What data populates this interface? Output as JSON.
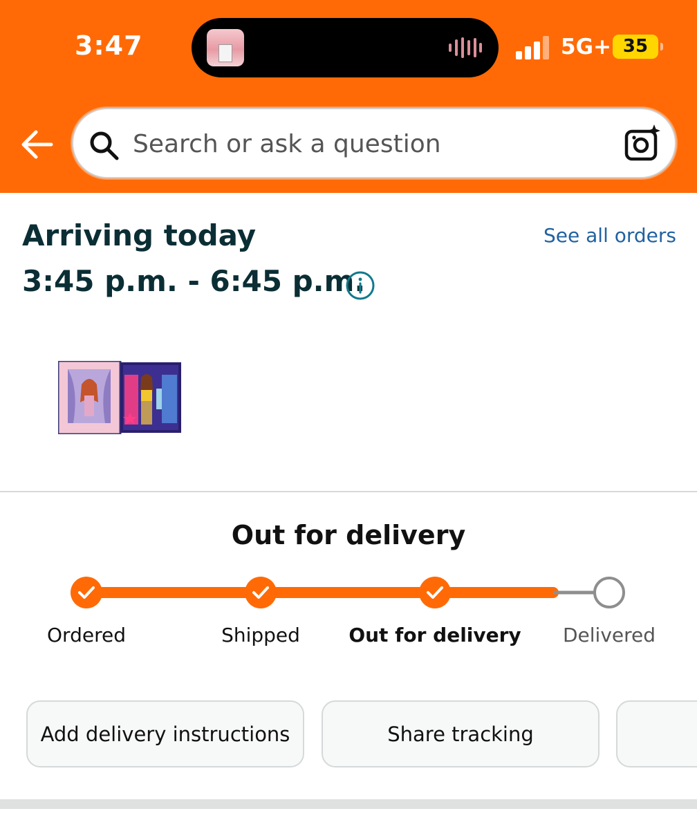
{
  "status_bar": {
    "time": "3:47",
    "network": "5G+",
    "battery": "35"
  },
  "search": {
    "placeholder": "Search or ask a question"
  },
  "delivery": {
    "heading": "Arriving today",
    "window": "3:45 p.m. - 6:45 p.m.",
    "see_all_orders": "See all orders"
  },
  "tracking": {
    "title": "Out for delivery",
    "steps": [
      {
        "label": "Ordered",
        "done": true
      },
      {
        "label": "Shipped",
        "done": true
      },
      {
        "label": "Out for delivery",
        "done": true,
        "current": true
      },
      {
        "label": "Delivered",
        "done": false
      }
    ]
  },
  "actions": {
    "delivery_instructions": "Add delivery instructions",
    "share_tracking": "Share tracking"
  },
  "colors": {
    "brand_orange": "#ff6a06",
    "heading": "#0b2e35",
    "link": "#2162a1",
    "info_teal": "#117a8b"
  },
  "icons": [
    "back-arrow-icon",
    "search-icon",
    "camera-search-icon",
    "info-icon",
    "checkmark-icon"
  ]
}
